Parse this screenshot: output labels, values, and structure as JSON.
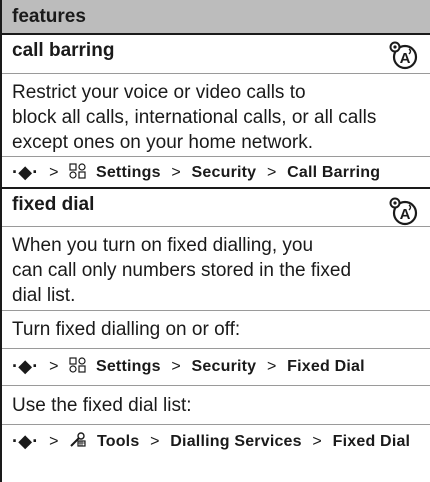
{
  "header": {
    "title": "features"
  },
  "sections": [
    {
      "title": "call barring",
      "description": "Restrict your voice or video calls to block all calls, international calls, or all calls except ones on your home network.",
      "description_lines": [
        "Restrict your voice or video calls to",
        "block all calls, international calls, or all calls",
        "except ones on your home network."
      ],
      "path": [
        "Settings",
        "Security",
        "Call Barring"
      ]
    },
    {
      "title": "fixed dial",
      "description_lines": [
        "When you turn on fixed dialling, you",
        "can call only numbers stored in the fixed",
        "dial list."
      ],
      "step1_label": "Turn fixed dialling on or off:",
      "step1_path": [
        "Settings",
        "Security",
        "Fixed Dial"
      ],
      "step2_label": "Use the fixed dial list:",
      "step2_path": [
        "Tools",
        "Dialling Services",
        "Fixed Dial"
      ]
    }
  ],
  "nav_symbol": "·◆·",
  "path_separator": ">",
  "icons": {
    "network_badge": "network-dependent-feature-icon",
    "settings": "settings-icon",
    "tools": "tools-icon",
    "nav_key": "navigation-key-icon"
  }
}
